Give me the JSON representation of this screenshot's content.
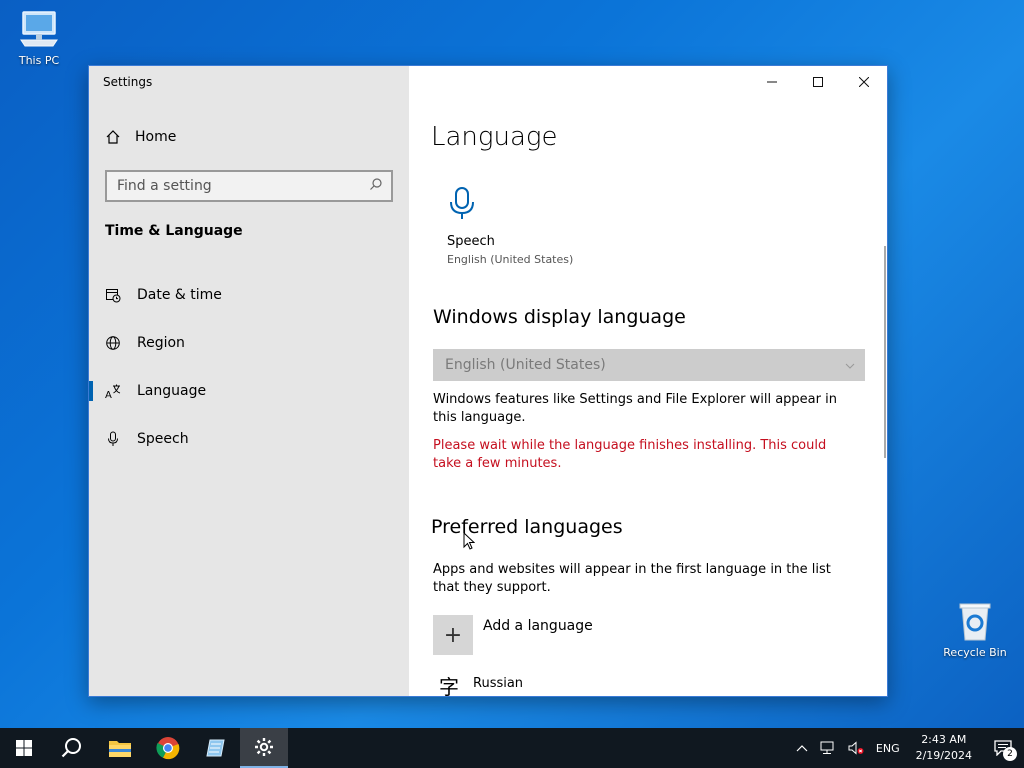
{
  "desktop": {
    "icons": [
      {
        "label": "This PC"
      },
      {
        "label": "Recycle Bin"
      }
    ]
  },
  "window": {
    "title": "Settings",
    "controls": {
      "minimize": "—",
      "maximize": "☐",
      "close": "✕"
    }
  },
  "sidebar": {
    "home_label": "Home",
    "search_placeholder": "Find a setting",
    "section_title": "Time & Language",
    "items": [
      {
        "label": "Date & time",
        "icon": "calendar-clock-icon"
      },
      {
        "label": "Region",
        "icon": "globe-icon"
      },
      {
        "label": "Language",
        "icon": "language-icon",
        "active": true
      },
      {
        "label": "Speech",
        "icon": "microphone-icon"
      }
    ]
  },
  "content": {
    "page_title": "Language",
    "speech_tile": {
      "title": "Speech",
      "subtitle": "English (United States)"
    },
    "display_language": {
      "heading": "Windows display language",
      "selected": "English (United States)",
      "description": "Windows features like Settings and File Explorer will appear in this language.",
      "warning": "Please wait while the language finishes installing. This could take a few minutes."
    },
    "preferred": {
      "heading": "Preferred languages",
      "description": "Apps and websites will appear in the first language in the list that they support.",
      "add_label": "Add a language",
      "languages": [
        {
          "name": "Russian"
        }
      ]
    }
  },
  "taskbar": {
    "tray": {
      "language": "ENG",
      "time": "2:43 AM",
      "date": "2/19/2024",
      "notifications": "2"
    }
  },
  "colors": {
    "accent": "#0063b1",
    "warning": "#c50f1f",
    "taskbar": "#101820"
  }
}
